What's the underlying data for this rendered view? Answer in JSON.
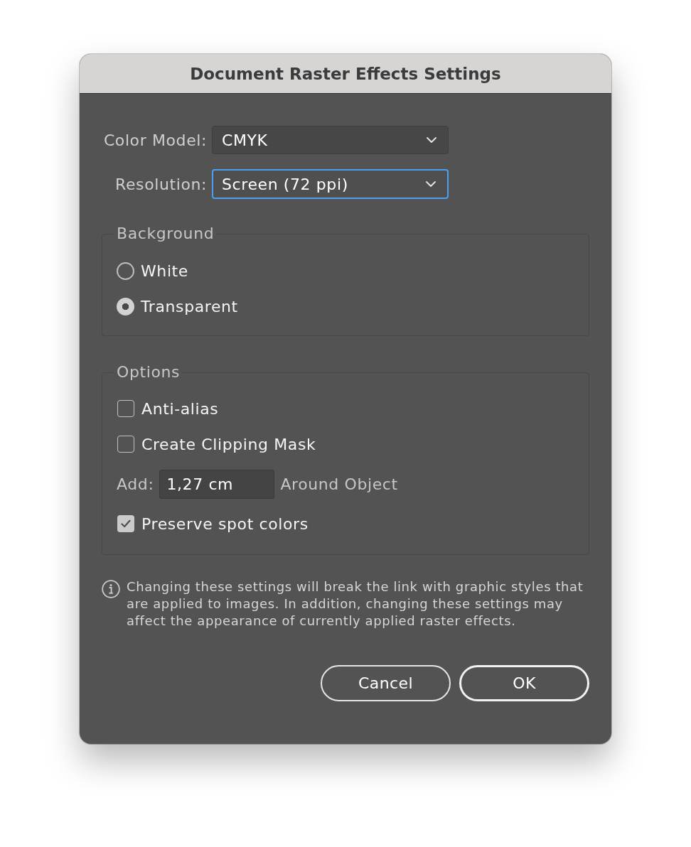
{
  "window": {
    "title": "Document Raster Effects Settings"
  },
  "fields": [
    {
      "label": "Color Model:",
      "value": "CMYK",
      "focused": false
    },
    {
      "label": "Resolution:",
      "value": "Screen (72 ppi)",
      "focused": true
    }
  ],
  "background": {
    "legend": "Background",
    "options": [
      {
        "label": "White",
        "selected": false
      },
      {
        "label": "Transparent",
        "selected": true
      }
    ]
  },
  "options": {
    "legend": "Options",
    "items": [
      {
        "kind": "checkbox",
        "label": "Anti-alias",
        "checked": false
      },
      {
        "kind": "checkbox",
        "label": "Create Clipping Mask",
        "checked": false
      },
      {
        "kind": "input",
        "label": "Add:",
        "value": "1,27 cm",
        "suffix": "Around Object"
      },
      {
        "kind": "checkbox",
        "label": "Preserve spot colors",
        "checked": true
      }
    ]
  },
  "note": "Changing these settings will break the link with graphic styles that are applied to images. In addition, changing these settings may affect the appearance of currently applied raster effects.",
  "buttons": [
    {
      "label": "Cancel",
      "default": false
    },
    {
      "label": "OK",
      "default": true
    }
  ]
}
